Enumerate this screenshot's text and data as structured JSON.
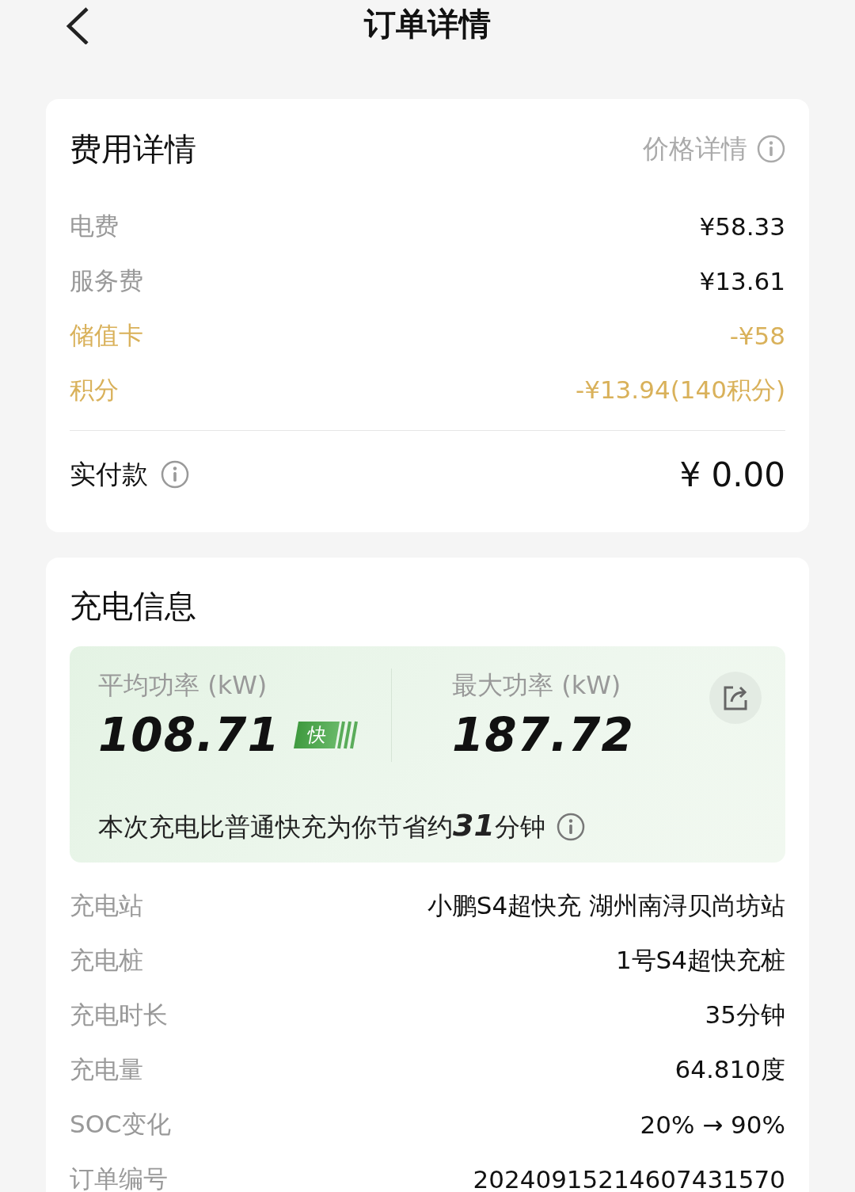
{
  "header": {
    "title": "订单详情"
  },
  "fees": {
    "title": "费用详情",
    "link": "价格详情",
    "rows": [
      {
        "label": "电费",
        "value": "¥58.33",
        "kind": "charge"
      },
      {
        "label": "服务费",
        "value": "¥13.61",
        "kind": "charge"
      },
      {
        "label": "储值卡",
        "value": "-¥58",
        "kind": "deduction"
      },
      {
        "label": "积分",
        "value": "-¥13.94(140积分)",
        "kind": "deduction"
      }
    ],
    "total": {
      "label": "实付款",
      "value": "¥ 0.00"
    }
  },
  "charging": {
    "title": "充电信息",
    "stats": [
      {
        "label": "平均功率 (kW)",
        "value": "108.71",
        "badge": "快"
      },
      {
        "label": "最大功率 (kW)",
        "value": "187.72"
      }
    ],
    "saving": "本次充电比普通快充为你节省约**31**分钟",
    "rows": [
      {
        "label": "充电站",
        "value": "小鹏S4超快充 湖州南浔贝尚坊站"
      },
      {
        "label": "充电桩",
        "value": "1号S4超快充桩"
      },
      {
        "label": "充电时长",
        "value": "35分钟"
      },
      {
        "label": "充电量",
        "value": "64.810度"
      },
      {
        "label": "SOC变化",
        "value": "20% → 90%"
      },
      {
        "label": "订单编号",
        "value": "20240915214607431570"
      }
    ]
  }
}
